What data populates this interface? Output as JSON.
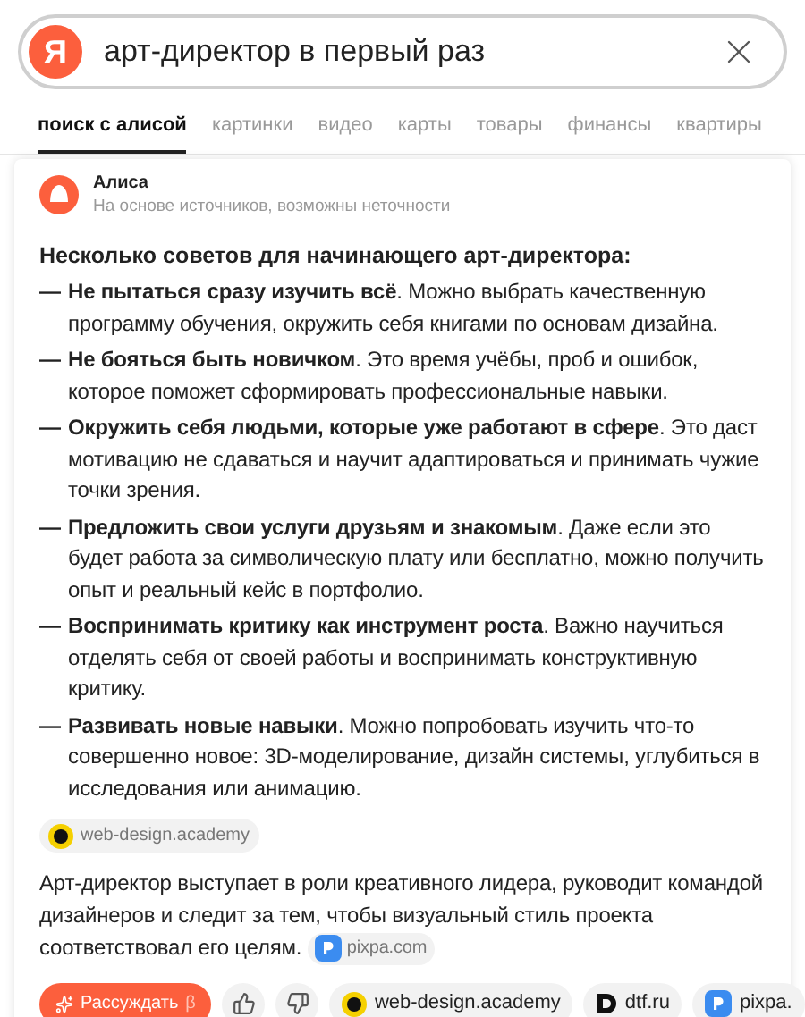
{
  "search": {
    "value": "арт-директор в первый раз",
    "logo": "Я"
  },
  "tabs": [
    {
      "label": "поиск с алисой",
      "selected": true
    },
    {
      "label": "картинки",
      "selected": false
    },
    {
      "label": "видео",
      "selected": false
    },
    {
      "label": "карты",
      "selected": false
    },
    {
      "label": "товары",
      "selected": false
    },
    {
      "label": "финансы",
      "selected": false
    },
    {
      "label": "квартиры",
      "selected": false
    }
  ],
  "answer": {
    "author": "Алиса",
    "disclaimer": "На основе источников, возможны неточности",
    "heading": "Несколько советов для начинающего арт-директора:",
    "items": [
      {
        "marker": "—",
        "text": "**Не пытаться сразу изучить всё**. Можно выбрать качественную программу обучения, окружить себя книгами по основам дизайна."
      },
      {
        "marker": "—",
        "text": "**Не бояться быть новичком**. Это время учёбы, проб и ошибок, которое поможет сформировать профессиональные навыки."
      },
      {
        "marker": "—",
        "text": "**Окружить себя людьми, которые уже работают в сфере**. Это даст мотивацию не сдаваться и научит адаптироваться и принимать чужие точки зрения."
      },
      {
        "marker": "—",
        "text": "**Предложить свои услуги друзьям и знакомым**. Даже если это будет работа за символическую плату или бесплатно, можно получить опыт и реальный кейс в портфолио."
      },
      {
        "marker": "—",
        "text": "**Воспринимать критику как инструмент роста**. Важно научиться отделять себя от своей работы и воспринимать конструктивную критику."
      },
      {
        "marker": "—",
        "text": "**Развивать новые навыки**. Можно попробовать изучить что-то совершенно новое: 3D-моделирование, дизайн системы, углубиться в исследования или анимацию."
      }
    ],
    "source": "web-design.academy",
    "summary": "Арт-директор выступает в роли креативного лидера, руководит командой дизайнеров и следит за тем, чтобы визуальный стиль проекта соответствовал его целям.",
    "summary_source": "pixpa.com"
  },
  "actions": {
    "reason_button": "Рассуждать",
    "beta": "β",
    "sources": [
      {
        "kind": "academy",
        "label": "web-design.academy"
      },
      {
        "kind": "dtf",
        "label": "dtf.ru"
      },
      {
        "kind": "pixpa",
        "label": "pixpa."
      }
    ]
  }
}
